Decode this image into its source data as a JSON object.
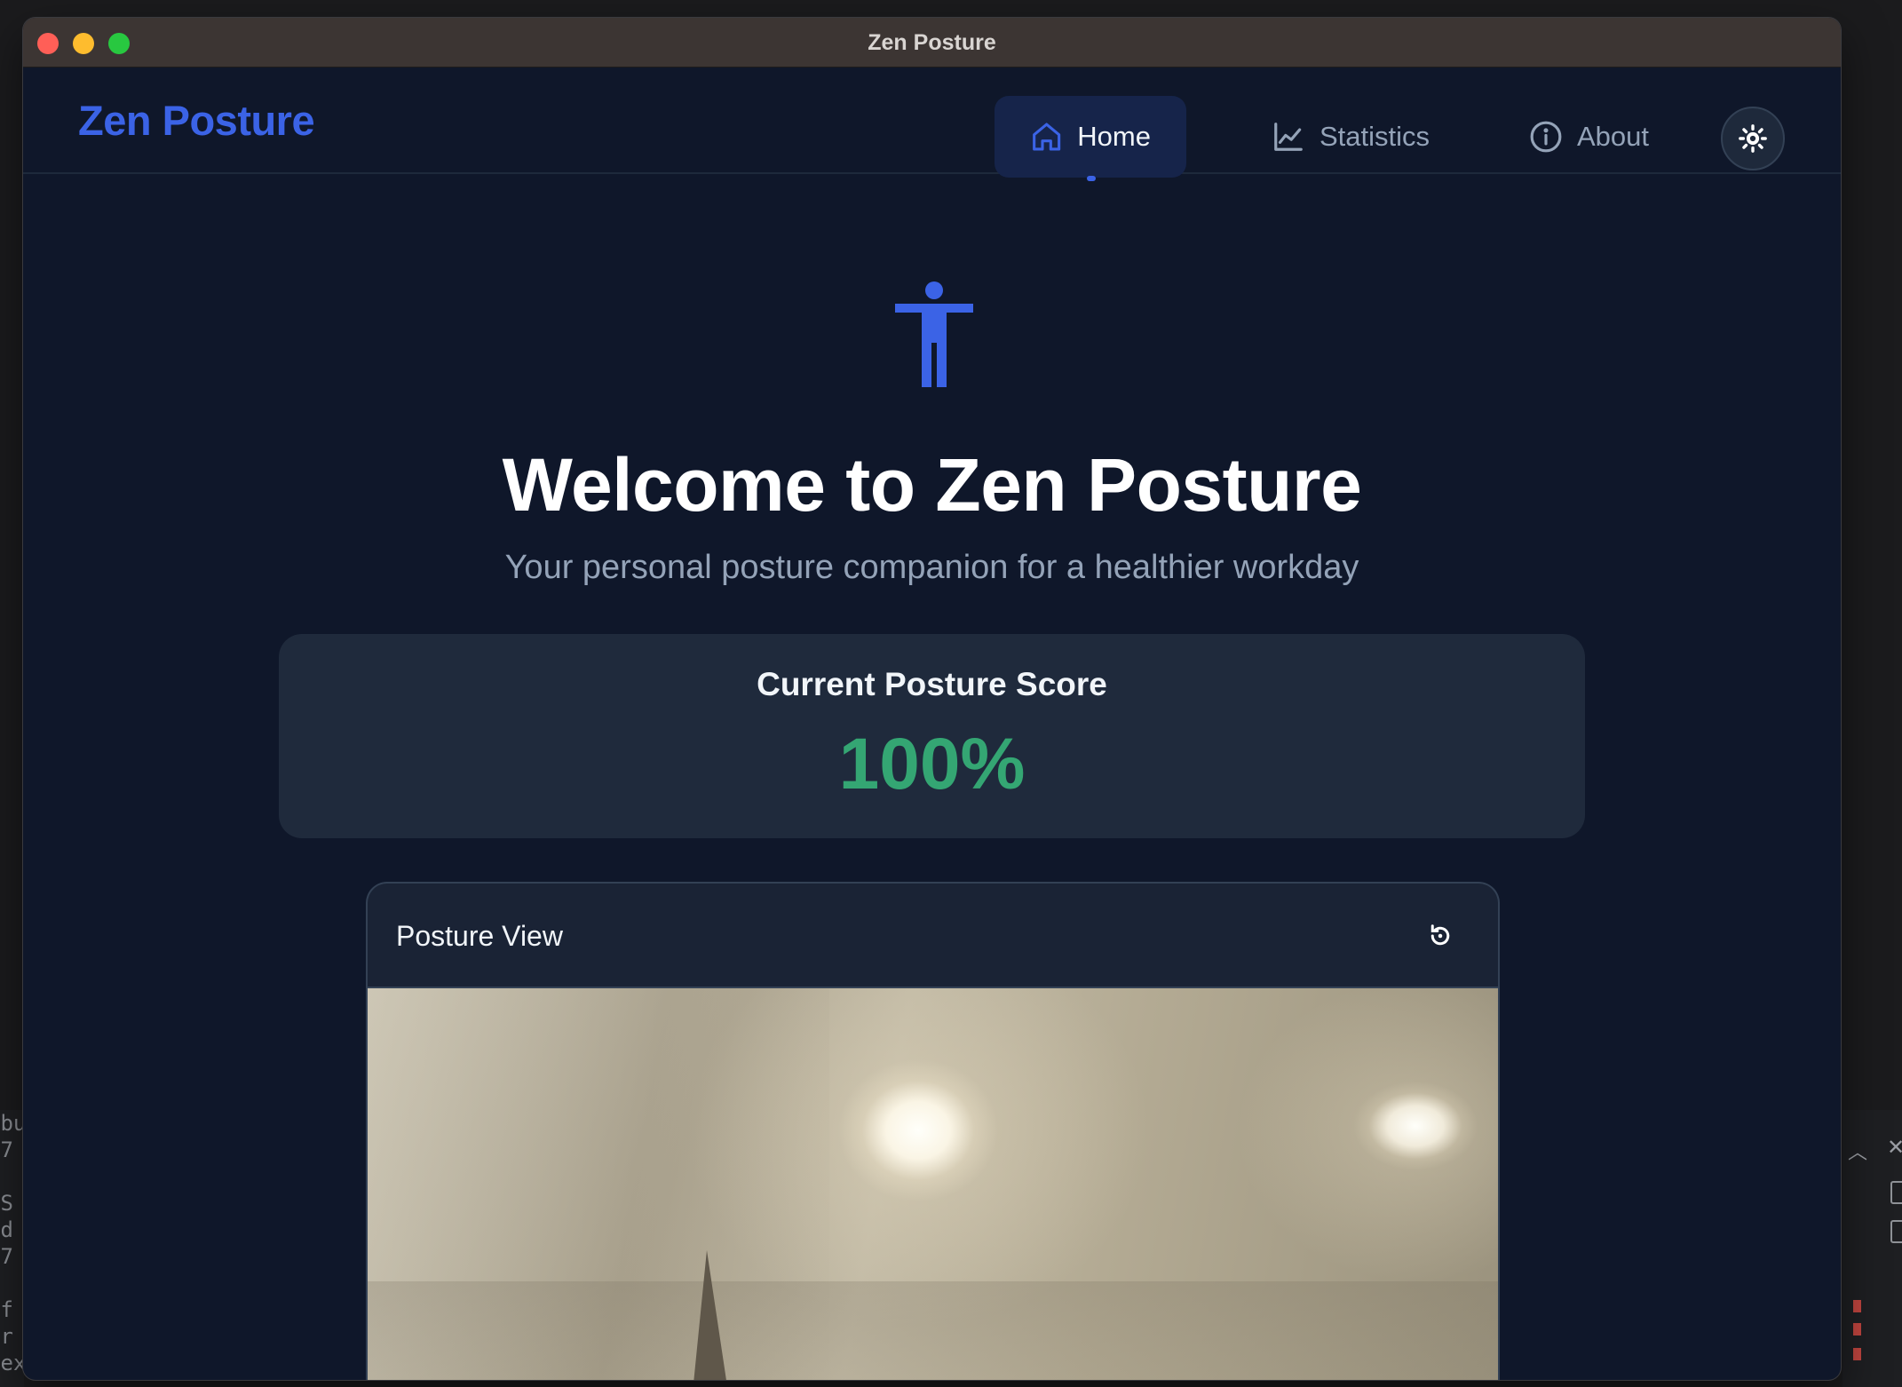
{
  "window": {
    "title": "Zen Posture"
  },
  "nav": {
    "brand": "Zen Posture",
    "items": [
      {
        "label": "Home",
        "icon": "home-icon",
        "active": true
      },
      {
        "label": "Statistics",
        "icon": "chart-line-icon",
        "active": false
      },
      {
        "label": "About",
        "icon": "info-icon",
        "active": false
      }
    ],
    "theme_toggle_icon": "sun-icon"
  },
  "hero": {
    "icon": "person-standing-icon",
    "title": "Welcome to Zen Posture",
    "subtitle": "Your personal posture companion for a healthier workday"
  },
  "score": {
    "label": "Current Posture Score",
    "value": "100%",
    "color": "#34a673"
  },
  "posture_view": {
    "title": "Posture View",
    "refresh_icon": "refresh-icon"
  },
  "colors": {
    "accent": "#3b63e6",
    "background": "#0f172a",
    "card": "#1f2a3c",
    "success": "#34a673"
  }
}
